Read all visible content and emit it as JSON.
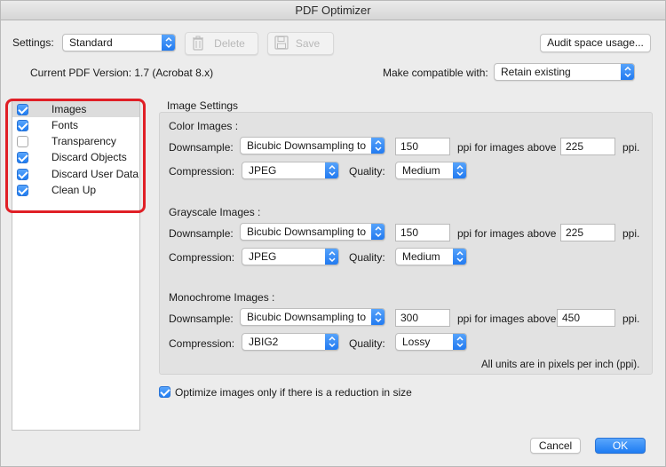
{
  "window": {
    "title": "PDF Optimizer"
  },
  "toolbar": {
    "settings_label": "Settings:",
    "settings_value": "Standard",
    "delete_label": "Delete",
    "save_label": "Save",
    "audit_label": "Audit space usage..."
  },
  "version": {
    "current_text": "Current PDF Version: 1.7 (Acrobat 8.x)",
    "compat_label": "Make compatible with:",
    "compat_value": "Retain existing"
  },
  "sidebar": {
    "items": [
      {
        "label": "Images",
        "checked": true,
        "selected": true
      },
      {
        "label": "Fonts",
        "checked": true,
        "selected": false
      },
      {
        "label": "Transparency",
        "checked": false,
        "selected": false
      },
      {
        "label": "Discard Objects",
        "checked": true,
        "selected": false
      },
      {
        "label": "Discard User Data",
        "checked": true,
        "selected": false
      },
      {
        "label": "Clean Up",
        "checked": true,
        "selected": false
      }
    ]
  },
  "image_settings": {
    "title": "Image Settings",
    "downsample_label": "Downsample:",
    "compression_label": "Compression:",
    "quality_label": "Quality:",
    "ppi_label": "ppi for images above",
    "ppi_unit": "ppi.",
    "color": {
      "heading": "Color Images :",
      "downsample": "Bicubic Downsampling to",
      "ppi": "150",
      "above": "225",
      "compression": "JPEG",
      "quality": "Medium"
    },
    "grayscale": {
      "heading": "Grayscale Images :",
      "downsample": "Bicubic Downsampling to",
      "ppi": "150",
      "above": "225",
      "compression": "JPEG",
      "quality": "Medium"
    },
    "mono": {
      "heading": "Monochrome Images :",
      "downsample": "Bicubic Downsampling to",
      "ppi": "300",
      "above": "450",
      "compression": "JBIG2",
      "quality": "Lossy"
    },
    "units_note": "All units are in pixels per inch (ppi)."
  },
  "optimize_option": {
    "label": "Optimize images only if there is a reduction in size",
    "checked": true
  },
  "footer": {
    "cancel_label": "Cancel",
    "ok_label": "OK"
  },
  "colors": {
    "accent": "#1f7df3",
    "highlight_red": "#e01f26"
  }
}
